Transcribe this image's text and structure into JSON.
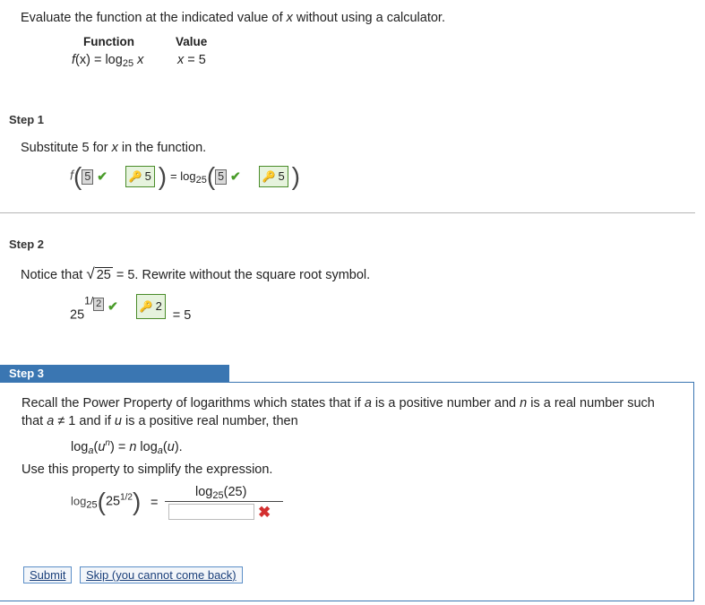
{
  "intro": {
    "before_x": "Evaluate the function at the indicated value of ",
    "x": "x",
    "after_x": " without using a calculator."
  },
  "table": {
    "function_header": "Function",
    "value_header": "Value",
    "function_f": "f",
    "function_rest": "(x) = log",
    "function_base": "25",
    "function_var": " x",
    "value_var": "x",
    "value_rest": " = 5"
  },
  "step1": {
    "label": "Step 1",
    "text_a": "Substitute ",
    "text_num": "5",
    "text_b": " for ",
    "text_x": "x",
    "text_c": " in the function.",
    "f": "f",
    "box1": "5",
    "key1": "5",
    "equals_log": "= log",
    "log_base": "25",
    "box2": "5",
    "key2": "5"
  },
  "step2": {
    "label": "Step 2",
    "text_a": "Notice that ",
    "radicand": "25",
    "text_b": " = 5.  Rewrite without the square root symbol.",
    "base": "25",
    "exp_prefix": "1/",
    "box": "2",
    "key": "2",
    "equals": "= 5"
  },
  "step3": {
    "label": "Step 3",
    "para1_a": "Recall the Power Property of logarithms which states that if ",
    "a1": "a",
    "para1_b": " is a positive number and ",
    "n1": "n",
    "para1_c": " is a real number such",
    "para2_a": "that ",
    "a2": "a",
    "para2_b": " ≠ 1 and if ",
    "u1": "u",
    "para2_c": " is a positive real number, then",
    "rule_log": "log",
    "rule_a": "a",
    "rule_u": "u",
    "rule_n": "n",
    "rule_eq": ") = ",
    "rule_n2": "n",
    "rule_log2": " log",
    "rule_a2": "a",
    "rule_u2": "u",
    "rule_end": ").",
    "use_text": "Use this property to simplify the expression.",
    "lhs_log": "log",
    "lhs_base": "25",
    "lhs_arg": "25",
    "lhs_exp": "1/2",
    "eq": "=",
    "num_log": "log",
    "num_base": "25",
    "num_arg": "(25)"
  },
  "buttons": {
    "submit": "Submit",
    "skip": "Skip (you cannot come back)"
  },
  "colors": {
    "step3_bar": "#3a76b2",
    "check": "#4a9c2a",
    "error": "#d32f2f"
  }
}
